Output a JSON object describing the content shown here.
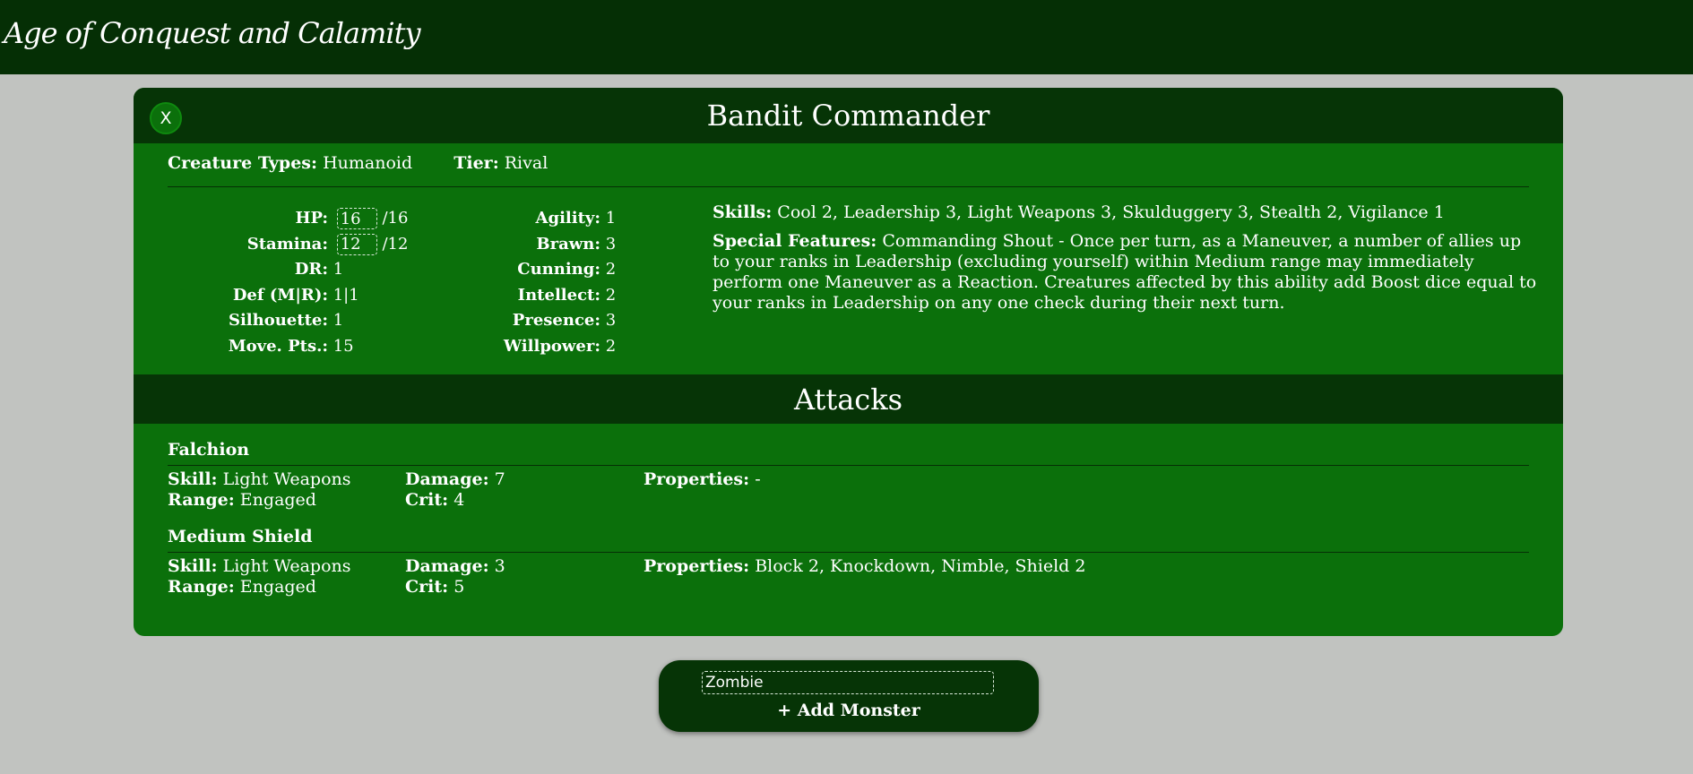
{
  "app": {
    "title": "Age of Conquest and Calamity"
  },
  "creature": {
    "name": "Bandit Commander",
    "close_label": "X",
    "types_label": "Creature Types:",
    "types_value": "Humanoid",
    "tier_label": "Tier:",
    "tier_value": "Rival",
    "stats_left": [
      {
        "label": "HP:",
        "input": "16",
        "suffix": "/16"
      },
      {
        "label": "Stamina:",
        "input": "12",
        "suffix": "/12"
      },
      {
        "label": "DR:",
        "value": "1"
      },
      {
        "label": "Def (M|R):",
        "value": "1|1"
      },
      {
        "label": "Silhouette:",
        "value": "1"
      },
      {
        "label": "Move. Pts.:",
        "value": "15"
      }
    ],
    "stats_right": [
      {
        "label": "Agility:",
        "value": "1"
      },
      {
        "label": "Brawn:",
        "value": "3"
      },
      {
        "label": "Cunning:",
        "value": "2"
      },
      {
        "label": "Intellect:",
        "value": "2"
      },
      {
        "label": "Presence:",
        "value": "3"
      },
      {
        "label": "Willpower:",
        "value": "2"
      }
    ],
    "skills_label": "Skills:",
    "skills_value": "Cool 2, Leadership 3, Light Weapons 3, Skulduggery 3, Stealth 2, Vigilance 1",
    "special_label": "Special Features:",
    "special_value": "Commanding Shout - Once per turn, as a Maneuver, a number of allies up to your ranks in Leadership (excluding yourself) within Medium range may immediately perform one Maneuver as a Reaction. Creatures affected by this ability add Boost dice equal to your ranks in Leadership on any one check during their next turn."
  },
  "attacks": {
    "title": "Attacks",
    "labels": {
      "skill": "Skill:",
      "range": "Range:",
      "damage": "Damage:",
      "crit": "Crit:",
      "properties": "Properties:"
    },
    "items": [
      {
        "name": "Falchion",
        "skill": "Light Weapons",
        "range": "Engaged",
        "damage": "7",
        "crit": "4",
        "properties": "-"
      },
      {
        "name": "Medium Shield",
        "skill": "Light Weapons",
        "range": "Engaged",
        "damage": "3",
        "crit": "5",
        "properties": "Block 2, Knockdown, Nimble, Shield 2"
      }
    ]
  },
  "add_monster": {
    "input_value": "Zombie",
    "button_label": "+ Add Monster"
  }
}
